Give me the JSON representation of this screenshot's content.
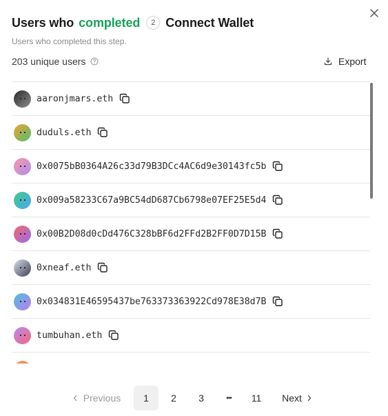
{
  "header": {
    "title_prefix": "Users who",
    "title_accent": "completed",
    "step_number": "2",
    "title_suffix": "Connect Wallet",
    "subtitle": "Users who completed this step.",
    "accent_color": "#1aa05a"
  },
  "summary": {
    "unique_users": "203 unique users",
    "export_label": "Export"
  },
  "users": [
    {
      "address": "aaronjmars.eth",
      "avatar_colors": [
        "#2b2b2b",
        "#8d8d8d"
      ]
    },
    {
      "address": "duduls.eth",
      "avatar_colors": [
        "#f0a23a",
        "#4fc06a"
      ]
    },
    {
      "address": "0x0075bB0364A26c33d79B3DCc4AC6d9e30143fc5b",
      "avatar_colors": [
        "#f49aa8",
        "#b28cf0"
      ]
    },
    {
      "address": "0x009a58233C67a9BC54dD687Cb6798e07EF25E5d4",
      "avatar_colors": [
        "#47c98a",
        "#4aa8f0"
      ]
    },
    {
      "address": "0x00B2D08d0cDd476C328bBF6d2FFd2B2FF0D7D15B",
      "avatar_colors": [
        "#f06a6a",
        "#9a6af0"
      ]
    },
    {
      "address": "0xneaf.eth",
      "avatar_colors": [
        "#d9dfe8",
        "#3b3f55"
      ]
    },
    {
      "address": "0x034831E46595437be763373363922Cd978E38d7B",
      "avatar_colors": [
        "#4ac3d9",
        "#c27af0"
      ]
    },
    {
      "address": "tumbuhan.eth",
      "avatar_colors": [
        "#b98af0",
        "#f06a7a"
      ]
    },
    {
      "address": "",
      "avatar_colors": [
        "#f0a060",
        "#f07a5a"
      ]
    }
  ],
  "pagination": {
    "previous_label": "Previous",
    "pages": [
      "1",
      "2",
      "3",
      "•••",
      "11"
    ],
    "current_page": "1",
    "next_label": "Next"
  },
  "icons": {
    "close": "close-icon",
    "info": "info-icon",
    "export": "download-icon",
    "copy": "copy-icon",
    "prev": "chevron-left-icon",
    "next": "chevron-right-icon"
  }
}
